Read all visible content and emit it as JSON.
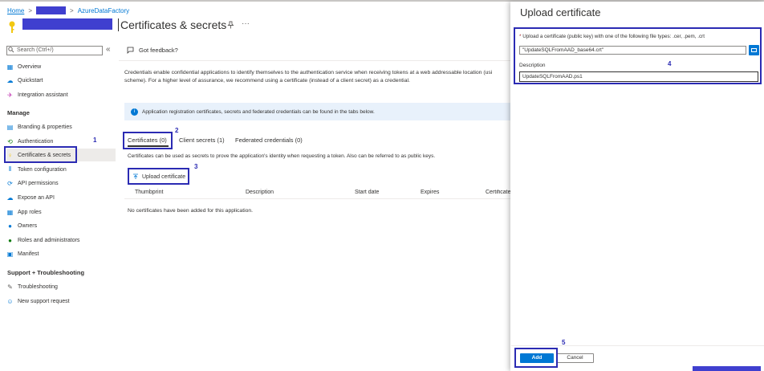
{
  "breadcrumb": {
    "home": "Home",
    "sep": ">",
    "app": "AzureDataFactory"
  },
  "header": {
    "title": "Certificates & secrets",
    "more": "···"
  },
  "sidebar": {
    "search_placeholder": "Search (Ctrl+/)",
    "collapse": "«",
    "items": [
      {
        "label": "Overview"
      },
      {
        "label": "Quickstart"
      },
      {
        "label": "Integration assistant"
      }
    ],
    "manage_header": "Manage",
    "manage_items": [
      {
        "label": "Branding & properties"
      },
      {
        "label": "Authentication"
      },
      {
        "label": "Certificates & secrets"
      },
      {
        "label": "Token configuration"
      },
      {
        "label": "API permissions"
      },
      {
        "label": "Expose an API"
      },
      {
        "label": "App roles"
      },
      {
        "label": "Owners"
      },
      {
        "label": "Roles and administrators"
      },
      {
        "label": "Manifest"
      }
    ],
    "support_header": "Support + Troubleshooting",
    "support_items": [
      {
        "label": "Troubleshooting"
      },
      {
        "label": "New support request"
      }
    ]
  },
  "main": {
    "feedback": "Got feedback?",
    "description_line1": "Credentials enable confidential applications to identify themselves to the authentication service when receiving tokens at a web addressable location (usi",
    "description_line2": "scheme). For a higher level of assurance, we recommend using a certificate (instead of a client secret) as a credential.",
    "info": "Application registration certificates, secrets and federated credentials can be found in the tabs below.",
    "tabs": [
      {
        "label": "Certificates (0)"
      },
      {
        "label": "Client secrets (1)"
      },
      {
        "label": "Federated credentials (0)"
      }
    ],
    "cert_desc": "Certificates can be used as secrets to prove the application's identity when requesting a token. Also can be referred to as public keys.",
    "upload_label": "Upload certificate",
    "columns": [
      "Thumbprint",
      "Description",
      "Start date",
      "Expires",
      "Certificate"
    ],
    "empty": "No certificates have been added for this application."
  },
  "panel": {
    "title": "Upload certificate",
    "file_label": "Upload a certificate (public key) with one of the following file types: .cer, .pem, .crt",
    "required_mark": "*",
    "file_value": "\"UpdateSQLFromAAD_base64.crt\"",
    "desc_label": "Description",
    "desc_value": "UpdateSQLFromAAD.ps1",
    "add_label": "Add",
    "cancel_label": "Cancel"
  },
  "annotations": [
    "1",
    "2",
    "3",
    "4",
    "5"
  ],
  "colors": {
    "accent": "#0078d4",
    "annotation": "#2b2bb3"
  }
}
